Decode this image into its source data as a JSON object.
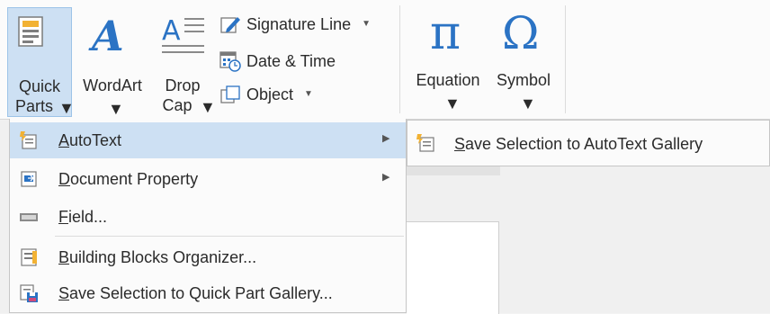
{
  "ribbon": {
    "quick_parts": {
      "line1": "Quick",
      "line2": "Parts"
    },
    "wordart": {
      "label": "WordArt"
    },
    "drop_cap": {
      "line1": "Drop",
      "line2": "Cap"
    },
    "signature_line": {
      "label": "Signature Line"
    },
    "date_time": {
      "label": "Date & Time"
    },
    "object": {
      "label": "Object"
    },
    "equation": {
      "label": "Equation"
    },
    "symbol": {
      "label": "Symbol"
    }
  },
  "menu": {
    "items": [
      {
        "label": "AutoText",
        "icon": "autotext-icon",
        "has_submenu": true,
        "highlighted": true
      },
      {
        "label": "Document Property",
        "icon": "document-property-icon",
        "has_submenu": true
      },
      {
        "label": "Field...",
        "icon": "field-icon",
        "has_submenu": false
      },
      {
        "label": "Building Blocks Organizer...",
        "icon": "building-blocks-icon",
        "has_submenu": false
      },
      {
        "label": "Save Selection to Quick Part Gallery...",
        "icon": "save-selection-icon",
        "has_submenu": false
      }
    ]
  },
  "submenu": {
    "items": [
      {
        "label": "Save Selection to AutoText Gallery",
        "icon": "save-autotext-icon"
      }
    ]
  },
  "colors": {
    "highlight": "#cde0f3",
    "accent": "#2b73c4",
    "ribbon_bg": "#fbfbfb"
  }
}
